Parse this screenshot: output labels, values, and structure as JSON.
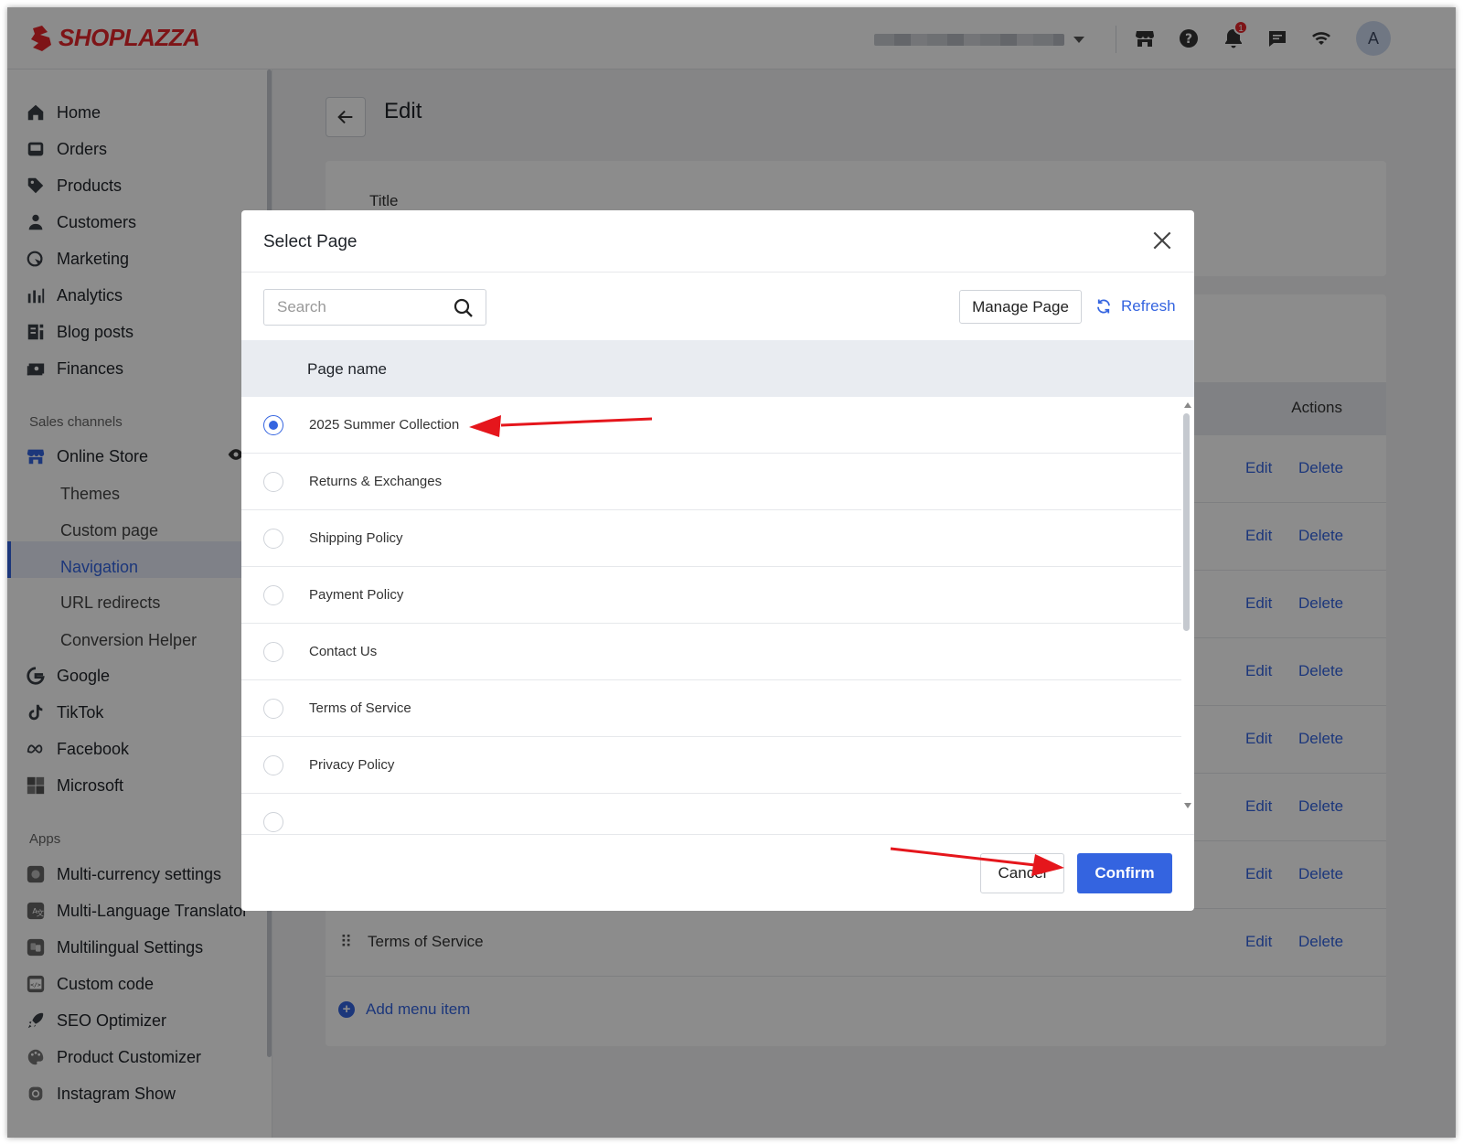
{
  "brand": {
    "name": "SHOPLAZZA",
    "color": "#e5262a"
  },
  "accent_color": "#3464e0",
  "topbar": {
    "icons": [
      "store-icon",
      "help-icon",
      "bell-icon",
      "chat-icon",
      "wifi-icon"
    ],
    "notification_count": "1",
    "avatar_initial": "A"
  },
  "sidebar": {
    "main_items": [
      {
        "label": "Home",
        "icon": "home-icon"
      },
      {
        "label": "Orders",
        "icon": "orders-icon"
      },
      {
        "label": "Products",
        "icon": "tag-icon"
      },
      {
        "label": "Customers",
        "icon": "person-icon"
      },
      {
        "label": "Marketing",
        "icon": "marketing-icon"
      },
      {
        "label": "Analytics",
        "icon": "bar-chart-icon"
      },
      {
        "label": "Blog posts",
        "icon": "blog-icon"
      },
      {
        "label": "Finances",
        "icon": "finance-icon"
      }
    ],
    "sales_channels_label": "Sales channels",
    "online_store": {
      "label": "Online Store",
      "icon": "store-icon"
    },
    "online_store_subitems": [
      "Themes",
      "Custom page",
      "Navigation",
      "URL redirects",
      "Conversion Helper"
    ],
    "active_subitem": "Navigation",
    "channels": [
      {
        "label": "Google",
        "icon": "google-icon"
      },
      {
        "label": "TikTok",
        "icon": "tiktok-icon"
      },
      {
        "label": "Facebook",
        "icon": "meta-icon"
      },
      {
        "label": "Microsoft",
        "icon": "microsoft-icon"
      }
    ],
    "apps_label": "Apps",
    "apps": [
      {
        "label": "Multi-currency settings",
        "icon": "app-icon"
      },
      {
        "label": "Multi-Language Translator",
        "icon": "translate-icon"
      },
      {
        "label": "Multilingual Settings",
        "icon": "app-icon"
      },
      {
        "label": "Custom code",
        "icon": "code-icon"
      },
      {
        "label": "SEO Optimizer",
        "icon": "rocket-icon"
      },
      {
        "label": "Product Customizer",
        "icon": "palette-icon"
      },
      {
        "label": "Instagram Show",
        "icon": "instagram-icon"
      }
    ]
  },
  "main": {
    "page_title": "Edit",
    "title_label": "Title",
    "actions_header": "Actions",
    "rows": [
      {
        "name": "",
        "edit": "Edit",
        "delete": "Delete"
      },
      {
        "name": "",
        "edit": "Edit",
        "delete": "Delete"
      },
      {
        "name": "",
        "edit": "Edit",
        "delete": "Delete"
      },
      {
        "name": "",
        "edit": "Edit",
        "delete": "Delete"
      },
      {
        "name": "",
        "edit": "Edit",
        "delete": "Delete"
      },
      {
        "name": "",
        "edit": "Edit",
        "delete": "Delete"
      },
      {
        "name": "",
        "edit": "Edit",
        "delete": "Delete"
      },
      {
        "name": "Terms of Service",
        "edit": "Edit",
        "delete": "Delete"
      }
    ],
    "add_item_label": "Add menu item"
  },
  "modal": {
    "title": "Select Page",
    "search_placeholder": "Search",
    "manage_label": "Manage Page",
    "refresh_label": "Refresh",
    "column_header": "Page name",
    "pages": [
      {
        "name": "2025 Summer Collection",
        "selected": true
      },
      {
        "name": "Returns & Exchanges",
        "selected": false
      },
      {
        "name": "Shipping Policy",
        "selected": false
      },
      {
        "name": "Payment Policy",
        "selected": false
      },
      {
        "name": "Contact Us",
        "selected": false
      },
      {
        "name": "Terms of Service",
        "selected": false
      },
      {
        "name": "Privacy Policy",
        "selected": false
      }
    ],
    "cancel_label": "Cancel",
    "confirm_label": "Confirm"
  },
  "annotation_color": "#e5161c"
}
